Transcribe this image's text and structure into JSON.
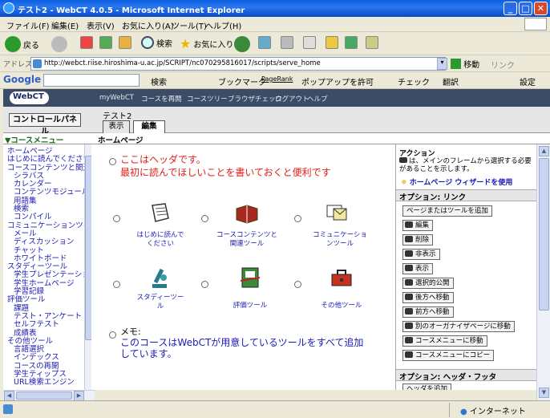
{
  "window": {
    "title": "テスト2 - WebCT 4.0.5 - Microsoft Internet Explorer"
  },
  "menubar": [
    "ファイル(F)",
    "編集(E)",
    "表示(V)",
    "お気に入り(A)",
    "ツール(T)",
    "ヘルプ(H)"
  ],
  "toolbar": {
    "back": "戻る",
    "search": "検索",
    "favorites": "お気に入り"
  },
  "address": {
    "label": "アドレス(D)",
    "url": "http://webct.riise.hiroshima-u.ac.jp/SCRIPT/nc070295816017/scripts/serve_home",
    "go": "移動",
    "links": "リンク"
  },
  "google": {
    "logo": "Google",
    "search": "検索",
    "bookmark": "ブックマーク",
    "pagerank": "PageRank",
    "popup": "ポップアップを許可",
    "check": "チェック",
    "translate": "翻訳",
    "settings": "設定"
  },
  "webct": {
    "logo": "WebCT",
    "nav": [
      "myWebCT",
      "コースを再開",
      "コースツリー",
      "ブラウザチェック",
      "ログアウト",
      "ヘルプ"
    ]
  },
  "control_panel": "コントロールパネル",
  "course_title": "テスト2",
  "tabs": {
    "view": "表示",
    "edit": "編集"
  },
  "course_menu_title": "▼コースメニュー",
  "home_title": "ホームページ",
  "sidebar": [
    {
      "label": "ホームページ",
      "level": 1
    },
    {
      "label": "はじめに読んでください",
      "level": 1
    },
    {
      "label": "コースコンテンツと関連ツール",
      "level": 1
    },
    {
      "label": "シラバス",
      "level": 2
    },
    {
      "label": "カレンダー",
      "level": 2
    },
    {
      "label": "コンテンツモジュール",
      "level": 2
    },
    {
      "label": "用語集",
      "level": 2
    },
    {
      "label": "検索",
      "level": 2
    },
    {
      "label": "コンパイル",
      "level": 2
    },
    {
      "label": "コミュニケーションツール",
      "level": 1
    },
    {
      "label": "メール",
      "level": 2
    },
    {
      "label": "ディスカッション",
      "level": 2
    },
    {
      "label": "チャット",
      "level": 2
    },
    {
      "label": "ホワイトボード",
      "level": 2
    },
    {
      "label": "スタディーツール",
      "level": 1
    },
    {
      "label": "学生プレゼンテーション",
      "level": 2
    },
    {
      "label": "学生ホームページ",
      "level": 2
    },
    {
      "label": "学習記録",
      "level": 2
    },
    {
      "label": "評価ツール",
      "level": 1
    },
    {
      "label": "課題",
      "level": 2
    },
    {
      "label": "テスト・アンケート",
      "level": 2
    },
    {
      "label": "セルフテスト",
      "level": 2
    },
    {
      "label": "成績表",
      "level": 2
    },
    {
      "label": "その他ツール",
      "level": 1
    },
    {
      "label": "言語選択",
      "level": 2
    },
    {
      "label": "インデックス",
      "level": 2
    },
    {
      "label": "コースの再開",
      "level": 2
    },
    {
      "label": "学生ティップス",
      "level": 2
    },
    {
      "label": "URL検索エンジン",
      "level": 2
    }
  ],
  "main": {
    "header_line1": "ここはヘッダです。",
    "header_line2": "最初に読んでほしいことを書いておくと便利です",
    "tools": [
      {
        "label": "はじめに読んで\nください",
        "icon": "document-icon"
      },
      {
        "label": "コースコンテンツと\n関連ツール",
        "icon": "books-icon"
      },
      {
        "label": "コミュニケーショ\nンツール",
        "icon": "letters-icon"
      },
      {
        "label": "スタディーツー\nル",
        "icon": "microscope-icon"
      },
      {
        "label": "評価ツール",
        "icon": "notebook-icon"
      },
      {
        "label": "その他ツール",
        "icon": "toolbox-icon"
      }
    ],
    "memo_label": "メモ:",
    "memo_line1": "このコースはWebCTが用意しているツールをすべて追加",
    "memo_line2": "しています。"
  },
  "actions": {
    "title": "アクション",
    "desc1": "は、メインのフレームから選択する必要",
    "desc2": "があることを示します。",
    "wizard": "ホームページ ウィザードを使用",
    "options_link": "オプション: リンク",
    "buttons": [
      "ページまたはツールを追加",
      "編集",
      "削除",
      "非表示",
      "表示",
      "選択的公開",
      "後方へ移動",
      "前方へ移動",
      "別のオーガナイザページに移動",
      "コースメニューに移動",
      "コースメニューにコピー"
    ],
    "options_hf": "オプション: ヘッダ・フッタ",
    "add_header": "ヘッダを追加"
  },
  "status": {
    "zone": "インターネット"
  },
  "colors": {
    "accent_red": "#e0201a",
    "link_blue": "#1a1ab4",
    "webct_bar": "#3c4c66",
    "titlebar": "#0a5fe0"
  }
}
